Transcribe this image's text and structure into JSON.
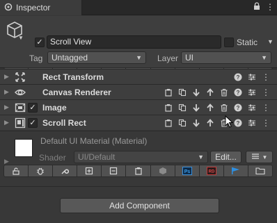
{
  "tab": {
    "title": "Inspector",
    "lock_icon": "lock-icon",
    "menu_icon": "kebab-menu-icon"
  },
  "gameobject": {
    "icon": "cube-icon",
    "active": true,
    "name": "Scroll View",
    "static_label": "Static",
    "static": false,
    "tag_label": "Tag",
    "tag": "Untagged",
    "layer_label": "Layer",
    "layer": "UI"
  },
  "toolbar_icons": [
    "lock-icon",
    "bug-icon",
    "wrench-icon",
    "add-square-icon",
    "remove-square-icon",
    "clipboard-icon",
    "box-icon",
    "photoshop-icon",
    "rd-icon",
    "blue-flag-icon",
    "folder-icon"
  ],
  "toolbar_icon_labels": {
    "photoshop": "Ps",
    "rd": "RD"
  },
  "components": [
    {
      "title": "Rect Transform",
      "icon": "rect-transform-icon",
      "has_checkbox": false,
      "enabled": null
    },
    {
      "title": "Canvas Renderer",
      "icon": "eye-icon",
      "has_checkbox": false,
      "enabled": null
    },
    {
      "title": "Image",
      "icon": "image-icon",
      "has_checkbox": true,
      "enabled": true
    },
    {
      "title": "Scroll Rect",
      "icon": "scroll-rect-icon",
      "has_checkbox": true,
      "enabled": true
    }
  ],
  "material": {
    "name": "Default UI Material (Material)",
    "shader_label": "Shader",
    "shader": "UI/Default",
    "edit_label": "Edit...",
    "swatch_color": "#ffffff"
  },
  "add_component_label": "Add Component",
  "colors": {
    "background": "#383838",
    "header": "#3e3e3e",
    "tabbar": "#282828",
    "field": "#2a2a2a",
    "button": "#585858"
  }
}
